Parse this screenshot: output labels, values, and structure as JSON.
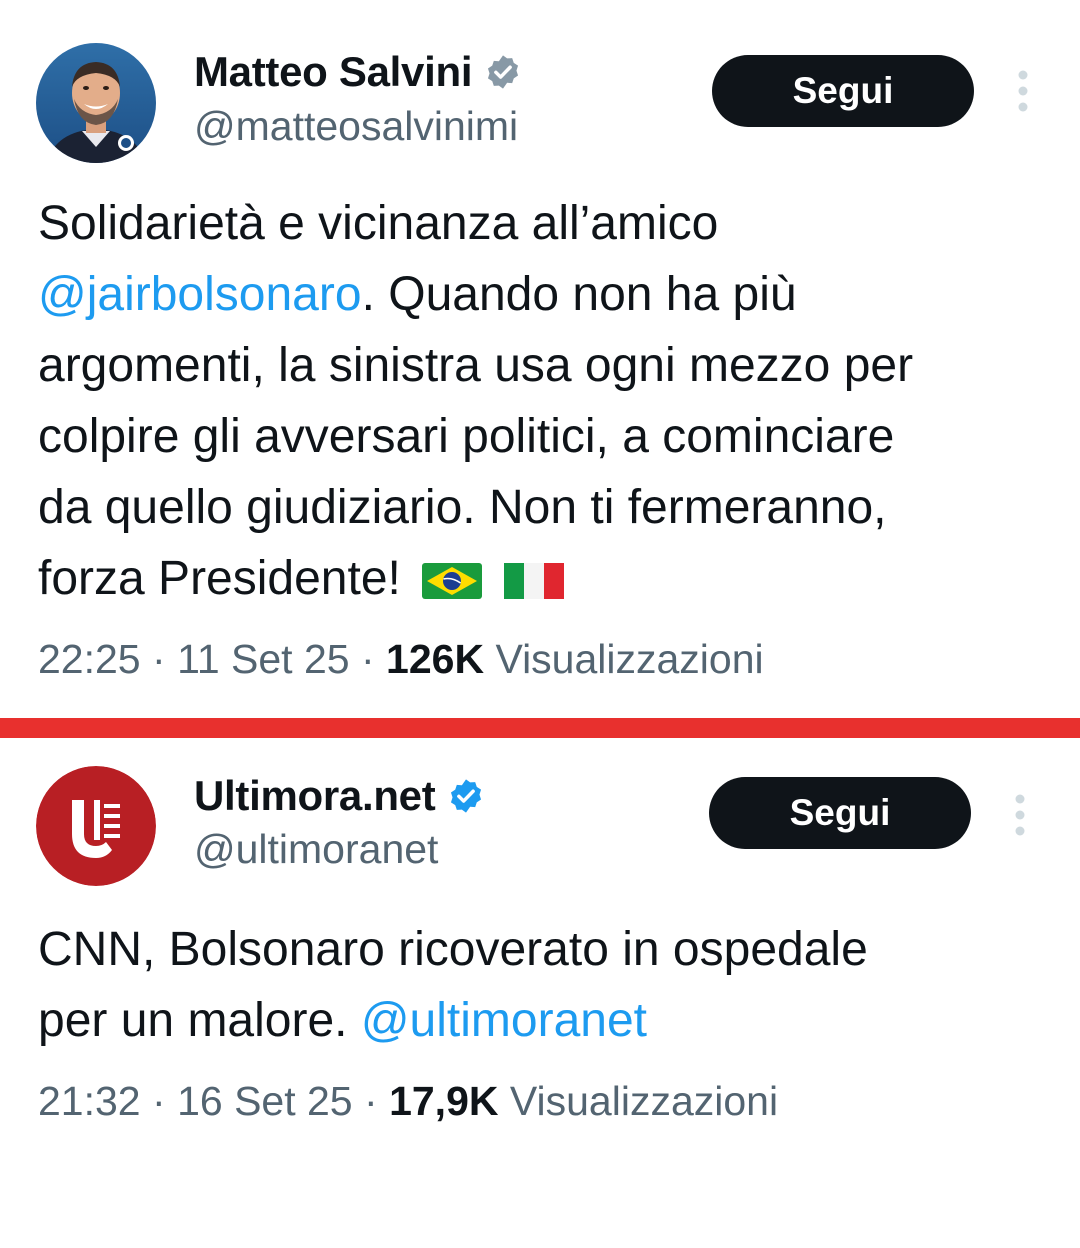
{
  "tweets": [
    {
      "author": {
        "name": "Matteo Salvini",
        "handle": "@matteosalvinimi",
        "verified_badge_color": "#8899a6"
      },
      "follow_label": "Segui",
      "text_lines": [
        {
          "before": "Solidarietà e vicinanza all’amico",
          "mention": "",
          "after": ""
        },
        {
          "before": "",
          "mention": "@jairbolsonaro",
          "after": ". Quando non ha più"
        },
        {
          "before": "argomenti, la sinistra usa ogni mezzo per",
          "mention": "",
          "after": ""
        },
        {
          "before": "colpire gli avversari politici, a cominciare",
          "mention": "",
          "after": ""
        },
        {
          "before": "da quello giudiziario. Non ti fermeranno,",
          "mention": "",
          "after": ""
        },
        {
          "before": "forza Presidente!",
          "mention": "",
          "after": ""
        }
      ],
      "flags": [
        "brazil-flag-icon",
        "italy-flag-icon"
      ],
      "time": "22:25",
      "date": "11 Set 25",
      "views_count": "126K",
      "views_label": "Visualizzazioni"
    },
    {
      "author": {
        "name": "Ultimora.net",
        "handle": "@ultimoranet",
        "verified_badge_color": "#1d9bf0"
      },
      "follow_label": "Segui",
      "text_lines": [
        {
          "before": "CNN, Bolsonaro ricoverato in ospedale",
          "mention": "",
          "after": ""
        },
        {
          "before": "per un malore. ",
          "mention": "@ultimoranet",
          "after": ""
        }
      ],
      "time": "21:32",
      "date": "16 Set 25",
      "views_count": "17,9K",
      "views_label": "Visualizzazioni"
    }
  ],
  "colors": {
    "separator": "#e8302e",
    "mention": "#1d9bf0",
    "muted_text": "#536471",
    "button_bg": "#0f1419",
    "ultimora_logo": "#b81f24"
  },
  "meta_separator": "·"
}
